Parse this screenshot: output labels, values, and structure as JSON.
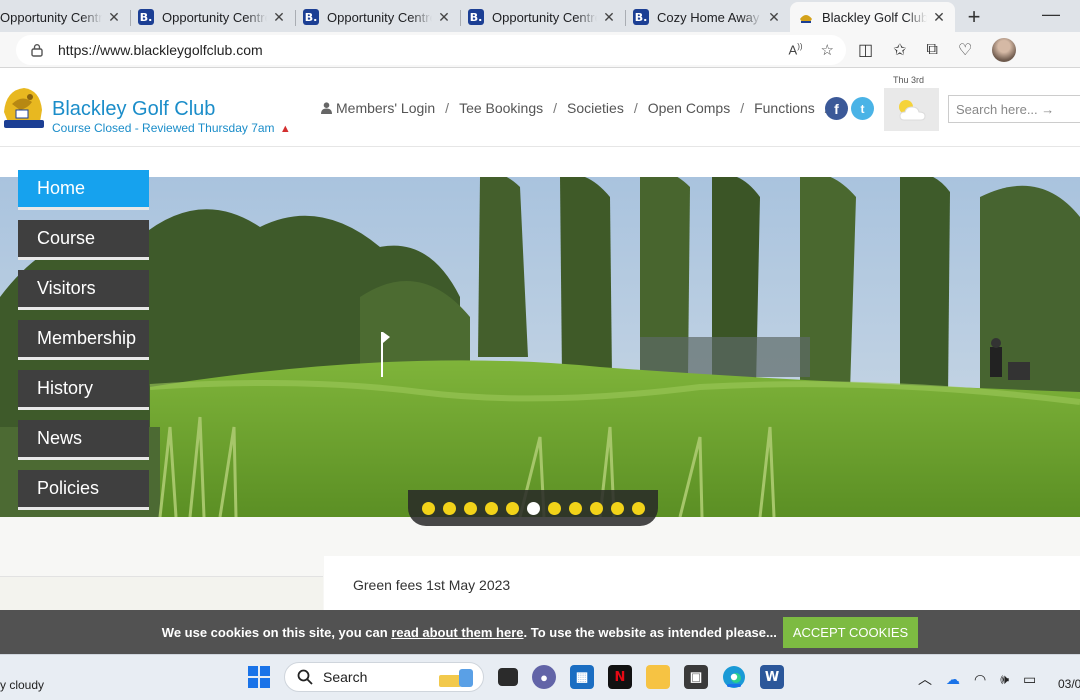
{
  "browser": {
    "tabs": [
      {
        "title": "Opportunity Centre",
        "favicon": "B."
      },
      {
        "title": "Opportunity Centre",
        "favicon": "B."
      },
      {
        "title": "Opportunity Centre",
        "favicon": "B."
      },
      {
        "title": "Opportunity Centre",
        "favicon": "B."
      },
      {
        "title": "Cozy Home Away Fr",
        "favicon": "B."
      },
      {
        "title": "Blackley Golf Club",
        "favicon": "golf-crest"
      }
    ],
    "close_glyph": "✕",
    "newtab_glyph": "+",
    "minimize_glyph": "—",
    "url": "https://www.blackleygolfclub.com"
  },
  "site": {
    "name": "Blackley Golf Club",
    "status": "Course Closed - Reviewed Thursday 7am",
    "status_icon": "warning-icon",
    "top_nav": [
      "Members' Login",
      "Tee Bookings",
      "Societies",
      "Open Comps",
      "Functions"
    ],
    "nav_separator": "/",
    "social": {
      "facebook": "f",
      "twitter": "t"
    },
    "weather": {
      "date": "Thu 3rd",
      "icon": "partly-cloudy-icon"
    },
    "search_placeholder": "Search here... →",
    "side_nav": [
      "Home",
      "Course",
      "Visitors",
      "Membership",
      "History",
      "News",
      "Policies"
    ],
    "active_side_nav": "Home",
    "slider": {
      "count": 11,
      "active_index": 5
    },
    "content_heading": "Green fees 1st May 2023"
  },
  "cookie": {
    "prefix": "We use cookies on this site, you can",
    "link": "read about them here",
    "suffix": ". To use the website as intended please...",
    "button": "ACCEPT COOKIES"
  },
  "taskbar": {
    "weather_text": "y cloudy",
    "search_label": "Search",
    "clock": "03/0"
  },
  "colors": {
    "brand_blue": "#1b8dc9",
    "nav_active": "#16a2ee",
    "nav_item": "#3f3f3f",
    "slider_dot": "#f2d319",
    "cookie_button": "#7dbb42"
  }
}
